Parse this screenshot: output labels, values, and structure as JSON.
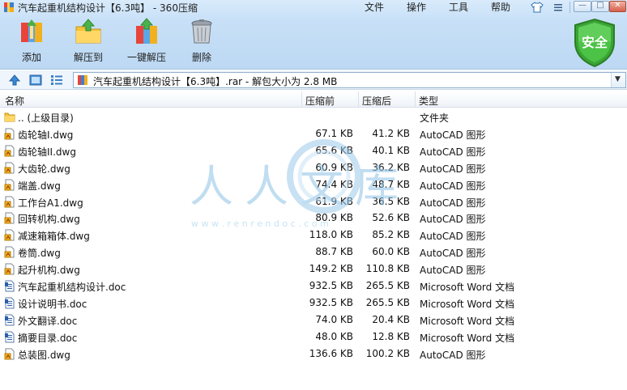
{
  "window": {
    "title": "汽车起重机结构设计【6.3吨】 - 360压缩",
    "menu": [
      "文件",
      "操作",
      "工具",
      "帮助"
    ],
    "controls": {
      "minimize": "—",
      "maximize": "□",
      "close": "✕"
    }
  },
  "toolbar": {
    "buttons": [
      {
        "label": "添加",
        "icon": "add-archive-icon"
      },
      {
        "label": "解压到",
        "icon": "extract-to-folder-icon"
      },
      {
        "label": "一键解压",
        "icon": "one-click-extract-icon"
      },
      {
        "label": "删除",
        "icon": "trash-icon"
      }
    ],
    "security_badge": "安全"
  },
  "address": {
    "path": "汽车起重机结构设计【6.3吨】.rar - 解包大小为 2.8 MB"
  },
  "columns": {
    "name": "名称",
    "compressed": "压缩前",
    "uncompressed": "压缩后",
    "type": "类型"
  },
  "files": [
    {
      "name": ".. (上级目录)",
      "compressed": "",
      "uncompressed": "",
      "type": "文件夹",
      "icon": "folder-icon"
    },
    {
      "name": "齿轮轴I.dwg",
      "compressed": "67.1 KB",
      "uncompressed": "41.2 KB",
      "type": "AutoCAD 图形",
      "icon": "dwg-file-icon"
    },
    {
      "name": "齿轮轴II.dwg",
      "compressed": "65.6 KB",
      "uncompressed": "40.1 KB",
      "type": "AutoCAD 图形",
      "icon": "dwg-file-icon"
    },
    {
      "name": "大齿轮.dwg",
      "compressed": "60.9 KB",
      "uncompressed": "36.2 KB",
      "type": "AutoCAD 图形",
      "icon": "dwg-file-icon"
    },
    {
      "name": "端盖.dwg",
      "compressed": "74.4 KB",
      "uncompressed": "48.7 KB",
      "type": "AutoCAD 图形",
      "icon": "dwg-file-icon"
    },
    {
      "name": "工作台A1.dwg",
      "compressed": "61.9 KB",
      "uncompressed": "36.5 KB",
      "type": "AutoCAD 图形",
      "icon": "dwg-file-icon"
    },
    {
      "name": "回转机构.dwg",
      "compressed": "80.9 KB",
      "uncompressed": "52.6 KB",
      "type": "AutoCAD 图形",
      "icon": "dwg-file-icon"
    },
    {
      "name": "减速箱箱体.dwg",
      "compressed": "118.0 KB",
      "uncompressed": "85.2 KB",
      "type": "AutoCAD 图形",
      "icon": "dwg-file-icon"
    },
    {
      "name": "卷筒.dwg",
      "compressed": "88.7 KB",
      "uncompressed": "60.0 KB",
      "type": "AutoCAD 图形",
      "icon": "dwg-file-icon"
    },
    {
      "name": "起升机构.dwg",
      "compressed": "149.2 KB",
      "uncompressed": "110.8 KB",
      "type": "AutoCAD 图形",
      "icon": "dwg-file-icon"
    },
    {
      "name": "汽车起重机结构设计.doc",
      "compressed": "932.5 KB",
      "uncompressed": "265.5 KB",
      "type": "Microsoft Word 文档",
      "icon": "doc-file-icon"
    },
    {
      "name": "设计说明书.doc",
      "compressed": "932.5 KB",
      "uncompressed": "265.5 KB",
      "type": "Microsoft Word 文档",
      "icon": "doc-file-icon"
    },
    {
      "name": "外文翻译.doc",
      "compressed": "74.0 KB",
      "uncompressed": "20.4 KB",
      "type": "Microsoft Word 文档",
      "icon": "doc-file-icon"
    },
    {
      "name": "摘要目录.doc",
      "compressed": "48.0 KB",
      "uncompressed": "12.8 KB",
      "type": "Microsoft Word 文档",
      "icon": "doc-file-icon"
    },
    {
      "name": "总装图.dwg",
      "compressed": "136.6 KB",
      "uncompressed": "100.2 KB",
      "type": "AutoCAD 图形",
      "icon": "dwg-file-icon"
    }
  ],
  "watermark": {
    "text": "人人文库",
    "subtext": "w w w . r e n r e n d o c . c o m"
  },
  "colors": {
    "accent": "#2f7fc6",
    "shield": "#3aa535",
    "toolbar_top": "#d9ebfb",
    "toolbar_bottom": "#bcd8f3"
  }
}
